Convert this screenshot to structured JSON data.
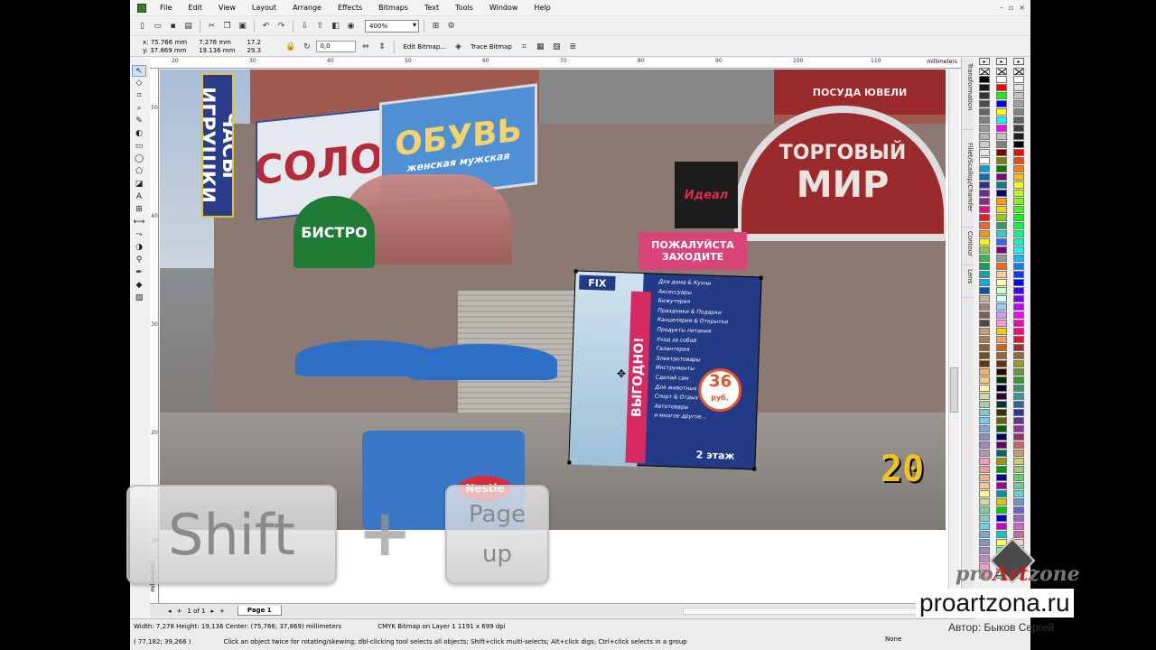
{
  "menu": [
    "File",
    "Edit",
    "View",
    "Layout",
    "Arrange",
    "Effects",
    "Bitmaps",
    "Text",
    "Tools",
    "Window",
    "Help"
  ],
  "toolbar": {
    "zoom_value": "400%"
  },
  "property_bar": {
    "x": "x: 75.766 mm",
    "y": "y: 37.869 mm",
    "width": "7.278 mm",
    "height": "19.136 mm",
    "scale_x": "17.2",
    "scale_y": "29.3",
    "angle": "0,0",
    "edit_bitmap_label": "Edit Bitmap...",
    "trace_bitmap_label": "Trace Bitmap"
  },
  "ruler": {
    "unit": "millimeters",
    "top_ticks": [
      "20",
      "30",
      "40",
      "50",
      "60",
      "70",
      "80",
      "90",
      "100",
      "110"
    ],
    "left_ticks": [
      "50",
      "40",
      "30",
      "20",
      "10"
    ],
    "left_unit": "millimeters"
  },
  "photo": {
    "sign_chasy": "ЧАСЫ ИГРУШКИ",
    "sign_solo": "СОЛО",
    "sign_obuv": "ОБУВЬ",
    "sign_obuv_sub": "женская мужская",
    "sign_torgovy": "ТОРГОВЫЙ",
    "sign_mir": "МИР",
    "sign_posuda": "ПОСУДА ЮВЕЛИ",
    "sign_idea": "Идеал",
    "sign_pozh": "ПОЖАЛУЙСТА ЗАХОДИТЕ",
    "sign_cafe": "БИСТРО",
    "cart_label": "Nestle",
    "year": "20"
  },
  "ad": {
    "logo": "FIX",
    "vertical": "ВЫГОДНО!",
    "items": [
      "Для дома & Кухни",
      "Аксессуары",
      "Бижутерия",
      "Праздники & Подарки",
      "Канцелярия & Открытки",
      "Продукты питания",
      "Уход за собой",
      "Галантерея",
      "Электротовары",
      "Инструменты",
      "Сделай сам",
      "Для животных",
      "Спорт & Отдых",
      "Автотовары",
      "и многое другое..."
    ],
    "price": "36",
    "currency": "руб.",
    "floor": "2 этаж"
  },
  "pagenav": {
    "counter": "1 of 1",
    "tab": "Page 1"
  },
  "status": {
    "dims": "Width: 7,278  Height: 19,136  Center: (75,766; 37,869)  millimeters",
    "object": "CMYK Bitmap on Layer 1 1191 x 699 dpi",
    "cursor": "( 77,182; 39,266 )",
    "hint": "Click an object twice for rotating/skewing; dbl-clicking tool selects all objects; Shift+click multi-selects; Alt+click digs; Ctrl+click selects in a group",
    "fill": "None"
  },
  "dockers": [
    "Transformation",
    "Fillet/Scallop/Chamfer",
    "Contour",
    "Lens"
  ],
  "palette": {
    "col1": [
      "#000000",
      "#1a1a1a",
      "#333333",
      "#4d4d4d",
      "#666666",
      "#808080",
      "#999999",
      "#b3b3b3",
      "#cccccc",
      "#e6e6e6",
      "#ffffff",
      "#00a3e0",
      "#0072bc",
      "#2e3192",
      "#662d91",
      "#92278f",
      "#ec008c",
      "#ed1c24",
      "#f26522",
      "#f7941d",
      "#fff200",
      "#8dc63f",
      "#39b54a",
      "#00a651",
      "#00a99d",
      "#00aeef",
      "#0054a6",
      "#c7b299",
      "#998675",
      "#736357",
      "#534741",
      "#c69c6d",
      "#a67c52",
      "#8c6239",
      "#754c24",
      "#603913",
      "#fbaf5d",
      "#fdc689",
      "#fff799",
      "#c4df9b",
      "#a3d39c",
      "#7accc8",
      "#6dcff6",
      "#7da7d9",
      "#8393ca",
      "#a187be",
      "#bd8cbf",
      "#f49ac1",
      "#f5989d",
      "#f9ad81",
      "#fdc68a",
      "#fff79a",
      "#c4df9b",
      "#82ca9c",
      "#7bcdc8",
      "#6ecff6",
      "#7ea7d8",
      "#8493ca",
      "#a186be",
      "#bc8cbf",
      "#f49bc1",
      "#f6989d",
      "#f9ad82",
      "#ffff00",
      "#00ff00",
      "#00ffff",
      "#0000ff",
      "#ff00ff",
      "#ff0000"
    ],
    "col2": [
      "#ffffff",
      "#ff0000",
      "#00ff00",
      "#0000ff",
      "#ffff00",
      "#00ffff",
      "#ff00ff",
      "#c0c0c0",
      "#808080",
      "#800000",
      "#808000",
      "#008000",
      "#800080",
      "#008080",
      "#000080",
      "#ff9900",
      "#ffcc00",
      "#99cc00",
      "#339966",
      "#33cccc",
      "#3366ff",
      "#800080",
      "#969696",
      "#ff6600",
      "#ffcc99",
      "#ffff99",
      "#ccffcc",
      "#ccffff",
      "#99ccff",
      "#cc99ff",
      "#ff99cc",
      "#ffcc00",
      "#ff9966",
      "#cc6600",
      "#996633",
      "#663300",
      "#330000",
      "#003300",
      "#000033",
      "#330033",
      "#003333",
      "#333300",
      "#666600",
      "#006600",
      "#000066",
      "#660066",
      "#006666",
      "#999900",
      "#009900",
      "#000099",
      "#990099",
      "#009999",
      "#cccc00",
      "#00cc00",
      "#0000cc",
      "#cc00cc",
      "#00cccc",
      "#ffff66",
      "#66ff66",
      "#6666ff",
      "#ff66ff",
      "#66ffff",
      "#ff6666",
      "#cccc66",
      "#66cc66",
      "#6666cc",
      "#cc66cc",
      "#66cccc",
      "#cc6666"
    ],
    "col3": [
      "#ffffff",
      "#e0e0e0",
      "#c0c0c0",
      "#a0a0a0",
      "#808080",
      "#606060",
      "#404040",
      "#202020",
      "#000000",
      "#ff0000",
      "#ff4000",
      "#ff8000",
      "#ffbf00",
      "#ffff00",
      "#bfff00",
      "#80ff00",
      "#40ff00",
      "#00ff00",
      "#00ff40",
      "#00ff80",
      "#00ffbf",
      "#00ffff",
      "#00bfff",
      "#0080ff",
      "#0040ff",
      "#0000ff",
      "#4000ff",
      "#8000ff",
      "#bf00ff",
      "#ff00ff",
      "#ff00bf",
      "#ff0080",
      "#ff0040",
      "#993333",
      "#996633",
      "#999933",
      "#669933",
      "#339933",
      "#339966",
      "#339999",
      "#336699",
      "#333399",
      "#663399",
      "#993399",
      "#993366",
      "#cc6666",
      "#cc9966",
      "#cccc66",
      "#99cc66",
      "#66cc66",
      "#66cc99",
      "#66cccc",
      "#6699cc",
      "#6666cc",
      "#9966cc",
      "#cc66cc",
      "#cc6699",
      "#ffcccc",
      "#ffe5cc",
      "#ffffcc",
      "#e5ffcc",
      "#ccffcc",
      "#ccffe5",
      "#ccffff",
      "#cce5ff",
      "#ccccff",
      "#e5ccff",
      "#ffccff"
    ]
  },
  "keys": {
    "shift": "Shift",
    "plus": "+",
    "pageup_line1": "Page",
    "pageup_line2": "up"
  },
  "watermark": {
    "logo_pre": "pro",
    "logo_art": "Art",
    "logo_post": "zone",
    "site": "proartzona.ru",
    "author": "Автор: Быков Сергей"
  }
}
